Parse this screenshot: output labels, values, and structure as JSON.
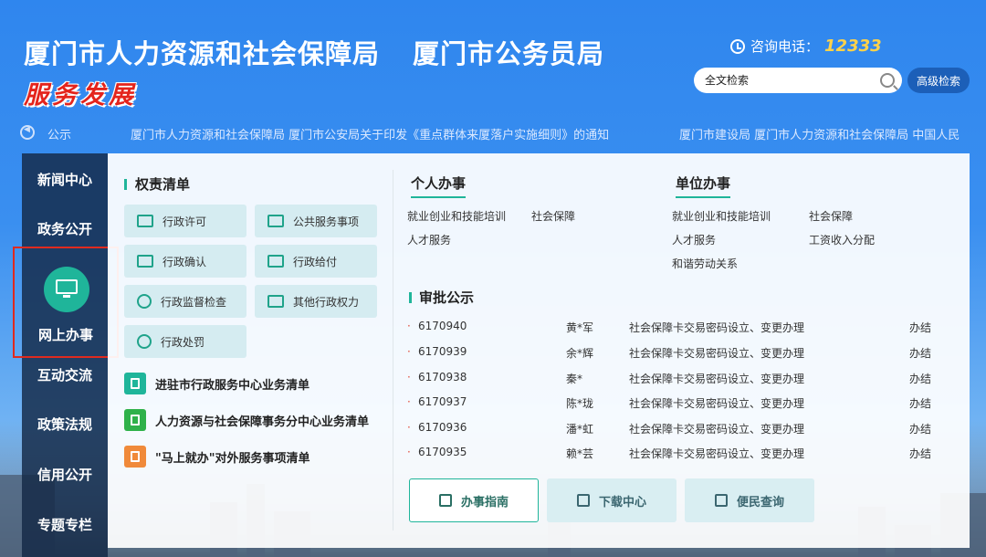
{
  "header": {
    "title_left": "厦门市人力资源和社会保障局",
    "title_right": "厦门市公务员局",
    "slogan": "服务发展",
    "hotline_label": "咨询电话：",
    "hotline_number": "12333"
  },
  "search": {
    "placeholder": "全文检索",
    "advanced_label": "高级检索"
  },
  "notice": {
    "label": "公示",
    "items": [
      "厦门市人力资源和社会保障局 厦门市公安局关于印发《重点群体来厦落户实施细则》的通知",
      "厦门市建设局 厦门市人力资源和社会保障局 中国人民"
    ]
  },
  "sidenav": {
    "items": [
      "新闻中心",
      "政务公开",
      "网上办事",
      "互动交流",
      "政策法规",
      "信用公开",
      "专题专栏"
    ],
    "active": "网上办事"
  },
  "powers": {
    "title": "权责清单",
    "tiles": [
      "行政许可",
      "公共服务事项",
      "行政确认",
      "行政给付",
      "行政监督检查",
      "其他行政权力",
      "行政处罚"
    ],
    "links": [
      "进驻市行政服务中心业务清单",
      "人力资源与社会保障事务分中心业务清单",
      "\"马上就办\"对外服务事项清单"
    ]
  },
  "personal": {
    "title": "个人办事",
    "links": [
      "就业创业和技能培训",
      "社会保障",
      "人才服务"
    ]
  },
  "unit": {
    "title": "单位办事",
    "links": [
      "就业创业和技能培训",
      "社会保障",
      "人才服务",
      "工资收入分配",
      "和谐劳动关系"
    ]
  },
  "approval": {
    "title": "审批公示",
    "rows": [
      {
        "id": "6170940",
        "name": "黄*军",
        "item": "社会保障卡交易密码设立、变更办理",
        "status": "办结"
      },
      {
        "id": "6170939",
        "name": "余*辉",
        "item": "社会保障卡交易密码设立、变更办理",
        "status": "办结"
      },
      {
        "id": "6170938",
        "name": "秦*",
        "item": "社会保障卡交易密码设立、变更办理",
        "status": "办结"
      },
      {
        "id": "6170937",
        "name": "陈*珑",
        "item": "社会保障卡交易密码设立、变更办理",
        "status": "办结"
      },
      {
        "id": "6170936",
        "name": "潘*虹",
        "item": "社会保障卡交易密码设立、变更办理",
        "status": "办结"
      },
      {
        "id": "6170935",
        "name": "赖*芸",
        "item": "社会保障卡交易密码设立、变更办理",
        "status": "办结"
      }
    ]
  },
  "buttons": {
    "guide": "办事指南",
    "download": "下载中心",
    "query": "便民查询"
  },
  "colors": {
    "accent": "#1fb59a",
    "highlight": "#e02a1f",
    "hotline": "#ffd24a"
  }
}
